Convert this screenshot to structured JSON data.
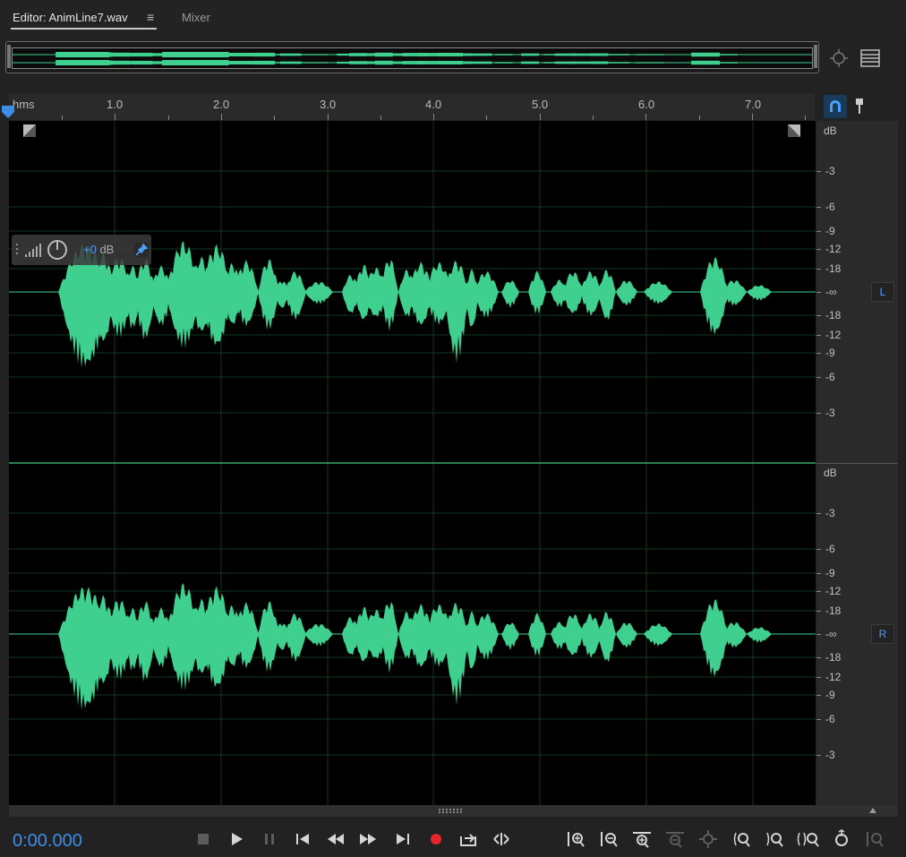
{
  "tabs": {
    "editor_label": "Editor: AnimLine7.wav",
    "menu_glyph": "≡",
    "mixer_label": "Mixer"
  },
  "ruler": {
    "unit": "hms",
    "labels": [
      "1.0",
      "2.0",
      "3.0",
      "4.0",
      "5.0",
      "6.0",
      "7.0"
    ]
  },
  "db_scale": {
    "header": "dB",
    "labels": [
      "-3",
      "-6",
      "-9",
      "-12",
      "-18",
      "-∞",
      "-18",
      "-12",
      "-9",
      "-6",
      "-3"
    ]
  },
  "channels": {
    "left": "L",
    "right": "R"
  },
  "hud": {
    "gain_value": "+0",
    "gain_unit": " dB"
  },
  "transport": {
    "time": "0:00.000"
  },
  "colors": {
    "waveform": "#3fd08f",
    "accent": "#3d8ee8",
    "record": "#e5262b"
  },
  "icons": {
    "overview_zoom": "zoom-fit-icon",
    "overview_list": "list-icon",
    "snap": "snap-magnet-icon",
    "pin": "pin-icon"
  }
}
